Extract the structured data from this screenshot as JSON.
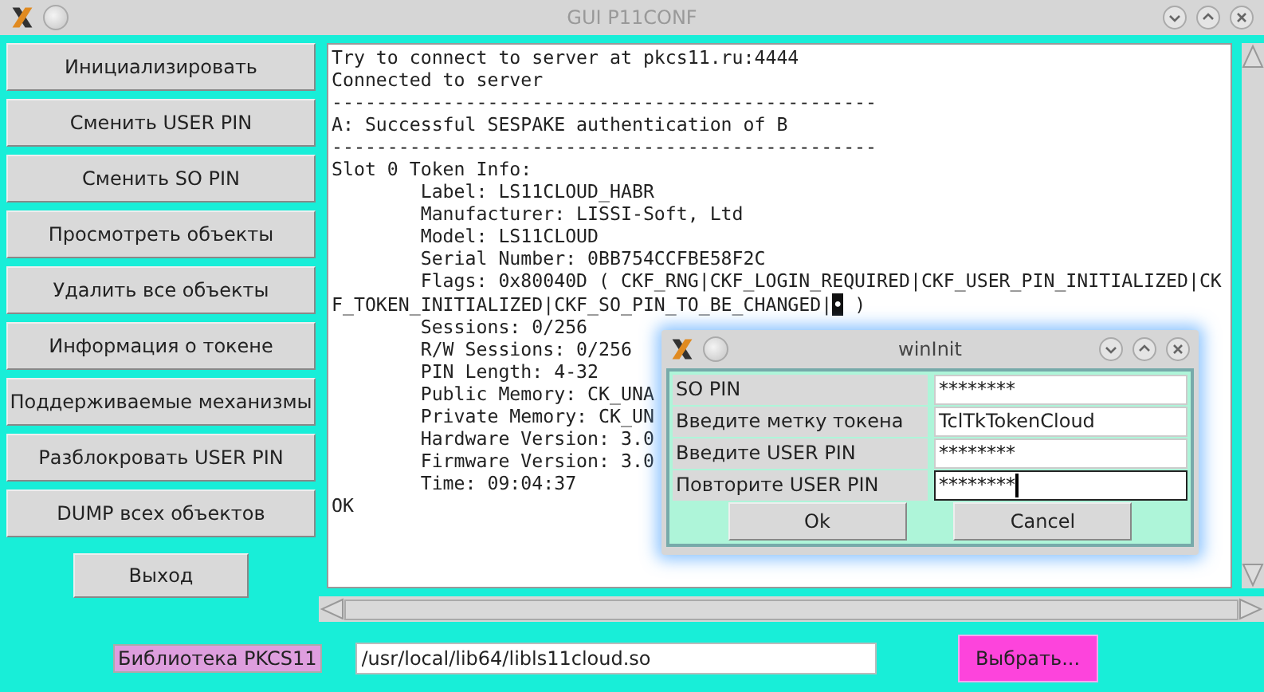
{
  "window": {
    "title": "GUI P11CONF"
  },
  "sidebar": {
    "buttons": [
      "Инициализировать",
      "Сменить USER PIN",
      "Сменить SO PIN",
      "Просмотреть объекты",
      "Удалить все объекты",
      "Информация о токене",
      "Поддерживаемые механизмы",
      "Разблокровать USER PIN",
      "DUMP всех объектов"
    ],
    "exit_button": "Выход"
  },
  "log": {
    "lines": [
      {
        "text": "Try to connect to server at pkcs11.ru:4444"
      },
      {
        "text": "Connected to server"
      },
      {
        "text": "-------------------------------------------------"
      },
      {
        "text": "A: Successful SESPAKE authentication of B"
      },
      {
        "text": "-------------------------------------------------"
      },
      {
        "text": "Slot 0 Token Info:"
      },
      {
        "text": "        Label: LS11CLOUD_HABR"
      },
      {
        "text": "        Manufacturer: LISSI-Soft, Ltd"
      },
      {
        "text": "        Model: LS11CLOUD"
      },
      {
        "text": "        Serial Number: 0BB754CCFBE58F2C"
      },
      {
        "text": "        Flags: 0x80040D ( CKF_RNG|CKF_LOGIN_REQUIRED|CKF_USER_PIN_INITIALIZED|CK"
      },
      {
        "text": "F_TOKEN_INITIALIZED|CKF_SO_PIN_TO_BE_CHANGED|",
        "selected_char": "•",
        "rest": " )"
      },
      {
        "text": "        Sessions: 0/256"
      },
      {
        "text": "        R/W Sessions: 0/256"
      },
      {
        "text": "        PIN Length: 4-32"
      },
      {
        "text": "        Public Memory: CK_UNA"
      },
      {
        "text": "        Private Memory: CK_UN"
      },
      {
        "text": "        Hardware Version: 3.0"
      },
      {
        "text": "        Firmware Version: 3.0"
      },
      {
        "text": "        Time: 09:04:37"
      },
      {
        "text": "OK"
      }
    ]
  },
  "library": {
    "label": "Библиотека PKCS11",
    "path": "/usr/local/lib64/libls11cloud.so",
    "choose_button": "Выбрать..."
  },
  "dialog": {
    "title": "winInit",
    "fields": [
      {
        "label": "SO PIN",
        "value": "********",
        "focused": false
      },
      {
        "label": "Введите метку токена",
        "value": "TclTkTokenCloud",
        "focused": false
      },
      {
        "label": "Введите USER PIN",
        "value": "********",
        "focused": false
      },
      {
        "label": "Повторите USER PIN",
        "value": "********",
        "focused": true
      }
    ],
    "buttons": [
      "Ok",
      "Cancel"
    ]
  }
}
